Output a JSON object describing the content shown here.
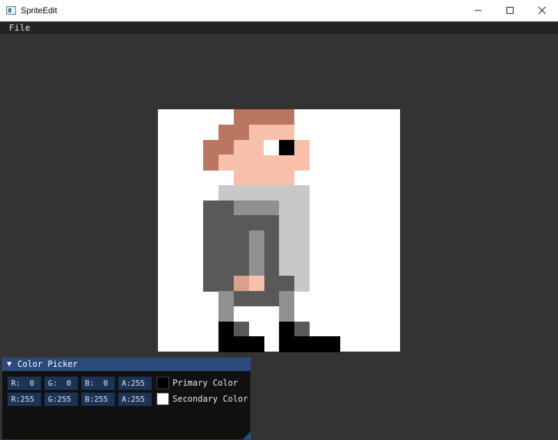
{
  "window": {
    "title": "SpriteEdit"
  },
  "menu": {
    "file_label": "File"
  },
  "canvas": {
    "grid_size": 16,
    "palette": {
      "hair": "#bb7660",
      "skin": "#f8c0aa",
      "eye_black": "#000000",
      "eye_white": "#ffffff",
      "collar": "#c8c8c8",
      "shirt_dark": "#595959",
      "shirt_mid": "#909090",
      "shirt_light": "#c8c8c8",
      "hand_shadow": "#d8a18c",
      "shoe": "#000000"
    }
  },
  "color_picker": {
    "title": "Color Picker",
    "primary": {
      "r": "R:  0",
      "g": "G:  0",
      "b": "B:  0",
      "a": "A:255",
      "label": "Primary Color",
      "swatch_color": "#000000"
    },
    "secondary": {
      "r": "R:255",
      "g": "G:255",
      "b": "B:255",
      "a": "A:255",
      "label": "Secondary Color",
      "swatch_color": "#ffffff"
    }
  }
}
